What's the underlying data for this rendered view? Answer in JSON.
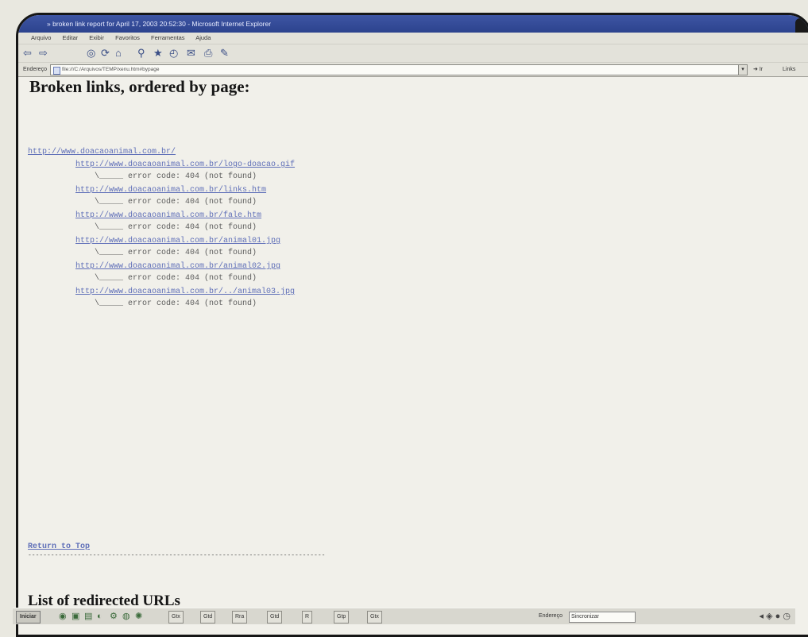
{
  "window": {
    "title": "» broken link report for April 17, 2003 20:52:30 - Microsoft Internet Explorer"
  },
  "menu": [
    "Arquivo",
    "Editar",
    "Exibir",
    "Favoritos",
    "Ferramentas",
    "Ajuda"
  ],
  "toolbar": {
    "icons": [
      "back-icon",
      "forward-icon",
      "stop-icon",
      "refresh-icon",
      "home-icon",
      "search-icon",
      "favorites-icon",
      "history-icon",
      "mail-icon",
      "print-icon",
      "edit-icon"
    ]
  },
  "address": {
    "label": "Endereço",
    "value": "file:///C:/Arquivos/TEMP/xenu.htm#bypage",
    "go_label": "Ir",
    "links_label": "Links"
  },
  "page": {
    "heading": "Broken links, ordered by page:",
    "parent_url": "http://www.doacaoanimal.com.br/",
    "broken": [
      {
        "url": "http://www.doacaoanimal.com.br/logo-doacao.gif",
        "error": "\\_____ error code: 404 (not found)"
      },
      {
        "url": "http://www.doacaoanimal.com.br/links.htm",
        "error": "\\_____ error code: 404 (not found)"
      },
      {
        "url": "http://www.doacaoanimal.com.br/fale.htm",
        "error": "\\_____ error code: 404 (not found)"
      },
      {
        "url": "http://www.doacaoanimal.com.br/animal01.jpg",
        "error": "\\_____ error code: 404 (not found)"
      },
      {
        "url": "http://www.doacaoanimal.com.br/animal02.jpg",
        "error": "\\_____ error code: 404 (not found)"
      },
      {
        "url": "http://www.doacaoanimal.com.br/../animal03.jpg",
        "error": "\\_____ error code: 404 (not found)"
      }
    ],
    "return_top": "Return to Top",
    "ruler": "------------------------------------------------------------------------------",
    "heading2": "List of redirected URLs"
  },
  "taskbar": {
    "start_label": "Iniciar",
    "tasks": [
      "Gtx",
      "Gtd",
      "Rra",
      "Gtd",
      "R",
      "Gtp",
      "Gtx"
    ],
    "address_label": "Endereço",
    "address_value": "Sincronizar"
  }
}
